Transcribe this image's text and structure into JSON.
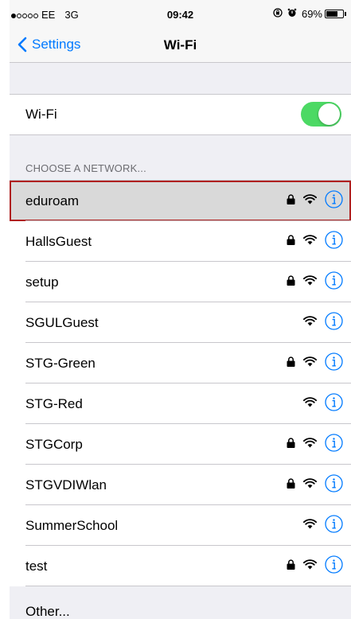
{
  "status_bar": {
    "carrier": "EE",
    "network_type": "3G",
    "time": "09:42",
    "battery": "69%",
    "battery_level": 0.69,
    "signal_bars_filled": 1,
    "signal_bars_total": 5
  },
  "nav": {
    "back_label": "Settings",
    "title": "Wi-Fi"
  },
  "wifi_toggle": {
    "label": "Wi-Fi",
    "enabled": true
  },
  "section_header": "CHOOSE A NETWORK...",
  "networks": [
    {
      "name": "eduroam",
      "locked": true,
      "selected": true
    },
    {
      "name": "HallsGuest",
      "locked": true,
      "selected": false
    },
    {
      "name": "setup",
      "locked": true,
      "selected": false
    },
    {
      "name": "SGULGuest",
      "locked": false,
      "selected": false
    },
    {
      "name": "STG-Green",
      "locked": true,
      "selected": false
    },
    {
      "name": "STG-Red",
      "locked": false,
      "selected": false
    },
    {
      "name": "STGCorp",
      "locked": true,
      "selected": false
    },
    {
      "name": "STGVDIWlan",
      "locked": true,
      "selected": false
    },
    {
      "name": "SummerSchool",
      "locked": false,
      "selected": false
    },
    {
      "name": "test",
      "locked": true,
      "selected": false
    }
  ],
  "other_label": "Other...",
  "colors": {
    "accent": "#007aff",
    "toggle_on": "#4cd964",
    "highlight_border": "#b02020",
    "selected_row": "#d9d9d9"
  },
  "icons": {
    "back": "chevron-left-icon",
    "lock": "lock-icon",
    "wifi": "wifi-icon",
    "info": "info-icon",
    "alarm": "alarm-icon",
    "rotation_lock": "rotation-lock-icon"
  }
}
